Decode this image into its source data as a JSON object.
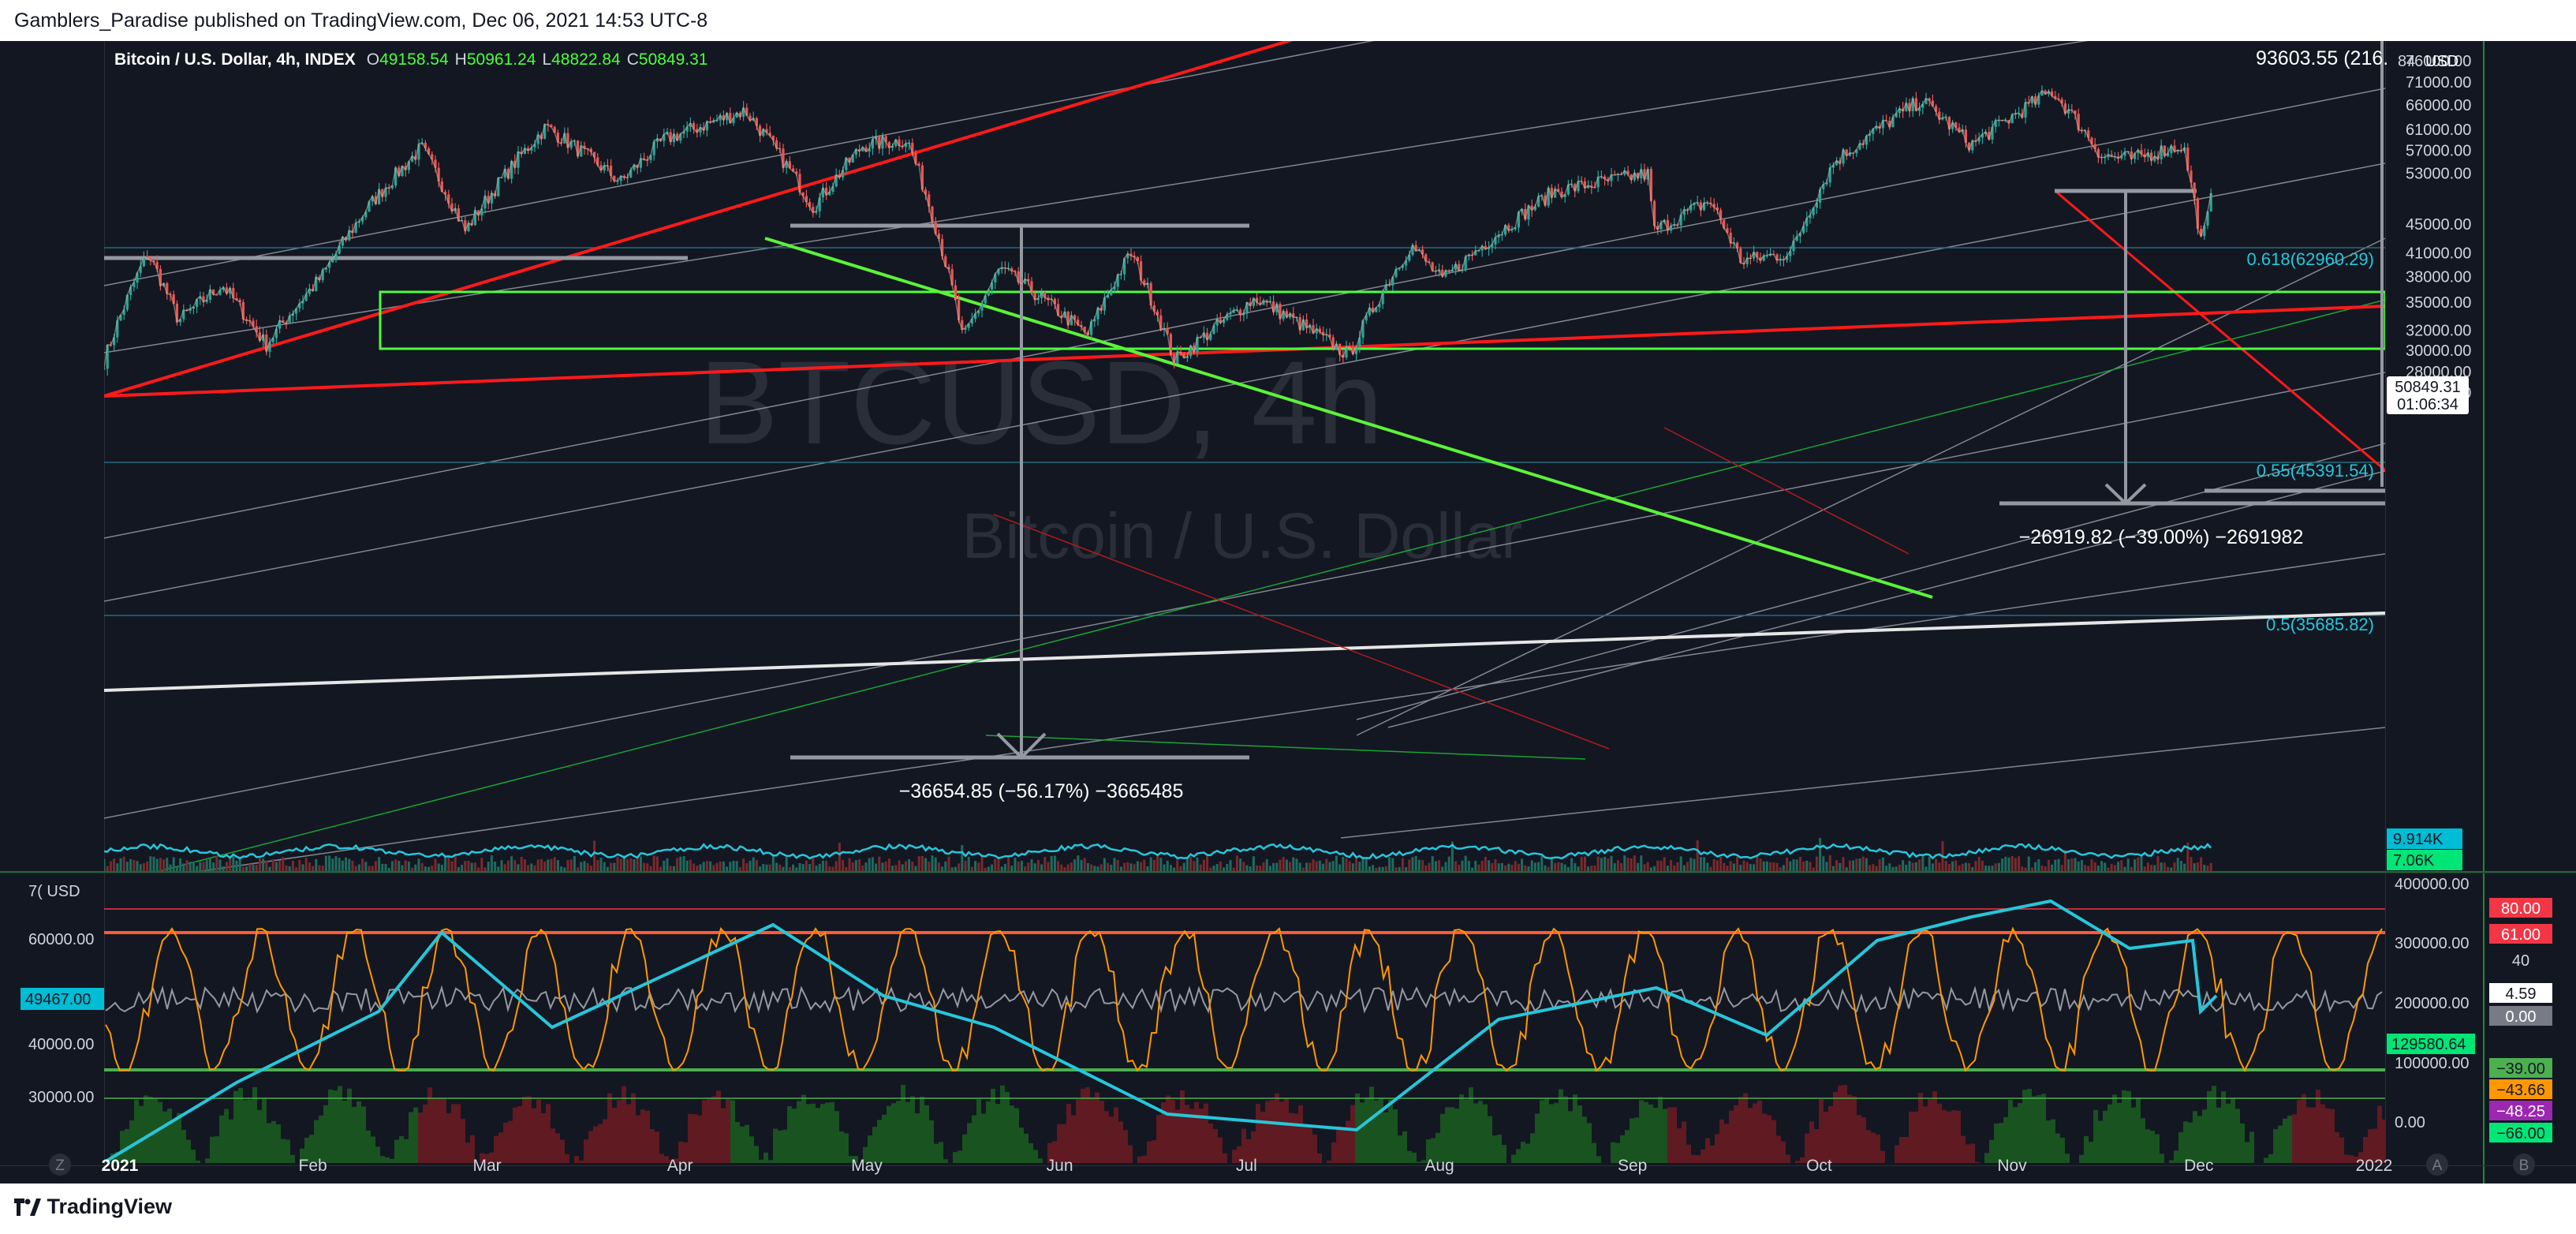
{
  "header": {
    "publisher": "Gamblers_Paradise published on TradingView.com, Dec 06, 2021 14:53 UTC-8"
  },
  "footer": {
    "brand": "TradingView"
  },
  "legend": {
    "symbol": "Bitcoin / U.S. Dollar, 4h, INDEX",
    "o_label": "O",
    "o": "49158.54",
    "h_label": "H",
    "h": "50961.24",
    "l_label": "L",
    "l": "48822.84",
    "c_label": "C",
    "c": "50849.31"
  },
  "watermark": {
    "main": "BTCUSD, 4h",
    "sub": "Bitcoin / U.S. Dollar"
  },
  "colors": {
    "bg": "#131722",
    "up": "#26a69a",
    "down": "#ef5350",
    "green_line": "#4cff3a",
    "red_line": "#ff1a1a",
    "cyan": "#26c6da",
    "orange": "#ff9800"
  },
  "price_axis": {
    "currency": "USD",
    "top_value": "84",
    "ticks": [
      "76000.00",
      "71000.00",
      "66000.00",
      "61000.00",
      "57000.00",
      "53000.00",
      "45000.00",
      "41000.00",
      "38000.00",
      "35000.00",
      "32000.00",
      "30000.00",
      "28000.00",
      "26200.00"
    ],
    "last_price": "50849.31",
    "countdown": "01:06:34",
    "vol_badge_1": "9.914K",
    "vol_badge_2": "7.06K"
  },
  "annotations": {
    "top_measure": "93603.55 (216.",
    "measure_1": "−36654.85 (−56.17%) −3665485",
    "measure_2": "−26919.82 (−39.00%) −2691982",
    "fib_618": "0.618(62960.29)",
    "fib_55": "0.55(45391.54)",
    "fib_5": "0.5(35685.82)"
  },
  "time_axis": {
    "labels": [
      "2021",
      "Feb",
      "Mar",
      "Apr",
      "May",
      "Jun",
      "Jul",
      "Aug",
      "Sep",
      "Oct",
      "Nov",
      "Dec",
      "2022"
    ],
    "z_button": "Z",
    "a_button": "A",
    "b_button": "B"
  },
  "indicator": {
    "left_label": "7( USD",
    "left_badge": "49467.00",
    "left_ticks": [
      "60000.00",
      "40000.00",
      "30000.00"
    ],
    "right_ticks": [
      "400000.00",
      "300000.00",
      "200000.00",
      "100000.00",
      "0.00"
    ],
    "right_badge": "129580.64",
    "level_badges": [
      {
        "text": "80.00",
        "bg": "#f23645",
        "fg": "#ffffff"
      },
      {
        "text": "61.00",
        "bg": "#f23645",
        "fg": "#ffffff"
      },
      {
        "text": "40",
        "bg": "#131722",
        "fg": "#d1d4dc"
      },
      {
        "text": "4.59",
        "bg": "#ffffff",
        "fg": "#131722"
      },
      {
        "text": "0.00",
        "bg": "#787b86",
        "fg": "#ffffff"
      },
      {
        "text": "−39.00",
        "bg": "#4caf50",
        "fg": "#131722"
      },
      {
        "text": "−43.66",
        "bg": "#ff9800",
        "fg": "#131722"
      },
      {
        "text": "−48.25",
        "bg": "#9c27b0",
        "fg": "#ffffff"
      },
      {
        "text": "−66.00",
        "bg": "#00e676",
        "fg": "#131722"
      }
    ]
  },
  "chart_data": {
    "type": "candlestick",
    "x_start": "2021-01-01",
    "x_end": "2021-12-06",
    "y_scale": "log",
    "ylim": [
      25000,
      86000
    ],
    "price_path": [
      [
        "2021-01-01",
        29000
      ],
      [
        "2021-01-08",
        41000
      ],
      [
        "2021-01-13",
        33000
      ],
      [
        "2021-01-20",
        37000
      ],
      [
        "2021-01-27",
        30500
      ],
      [
        "2021-02-05",
        38000
      ],
      [
        "2021-02-12",
        47000
      ],
      [
        "2021-02-21",
        57500
      ],
      [
        "2021-02-28",
        44000
      ],
      [
        "2021-03-13",
        61500
      ],
      [
        "2021-03-25",
        51500
      ],
      [
        "2021-04-01",
        59000
      ],
      [
        "2021-04-14",
        64800
      ],
      [
        "2021-04-25",
        47500
      ],
      [
        "2021-05-03",
        58000
      ],
      [
        "2021-05-10",
        59000
      ],
      [
        "2021-05-19",
        31000
      ],
      [
        "2021-05-25",
        39000
      ],
      [
        "2021-06-08",
        31500
      ],
      [
        "2021-06-15",
        41000
      ],
      [
        "2021-06-22",
        29000
      ],
      [
        "2021-07-05",
        35500
      ],
      [
        "2021-07-20",
        29500
      ],
      [
        "2021-07-30",
        42000
      ],
      [
        "2021-08-04",
        37500
      ],
      [
        "2021-08-22",
        50000
      ],
      [
        "2021-09-06",
        52900
      ],
      [
        "2021-09-07",
        44000
      ],
      [
        "2021-09-16",
        48500
      ],
      [
        "2021-09-21",
        40000
      ],
      [
        "2021-09-29",
        41000
      ],
      [
        "2021-10-06",
        55000
      ],
      [
        "2021-10-20",
        67000
      ],
      [
        "2021-10-28",
        58000
      ],
      [
        "2021-11-10",
        69000
      ],
      [
        "2021-11-18",
        56000
      ],
      [
        "2021-11-23",
        55500
      ],
      [
        "2021-12-01",
        58000
      ],
      [
        "2021-12-04",
        42000
      ],
      [
        "2021-12-06",
        50849
      ]
    ]
  }
}
